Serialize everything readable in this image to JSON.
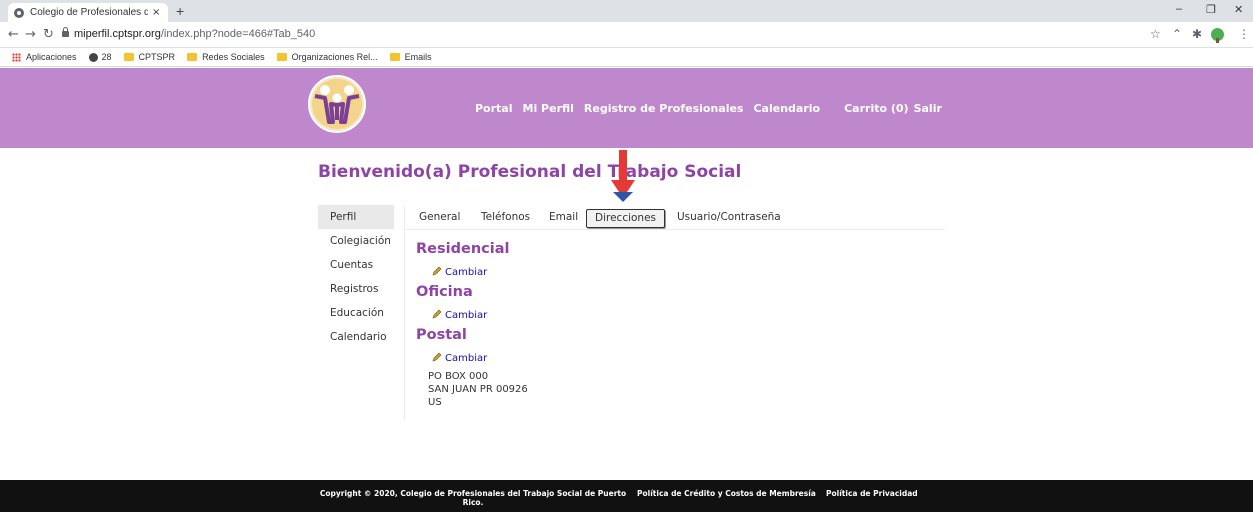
{
  "browser": {
    "tab_title": "Colegio de Profesionales del Trab",
    "tab_close": "×",
    "new_tab": "+",
    "window_controls": {
      "minimize": "–",
      "restore": "❐",
      "close": "✕"
    },
    "url_host": "miperfil.cptspr.org",
    "url_path": "/index.php?node=466#Tab_540",
    "bookmarks": [
      {
        "label": "Aplicaciones",
        "icon": "apps-grid-icon"
      },
      {
        "label": "28",
        "icon": "globe-icon"
      },
      {
        "label": "CPTSPR",
        "icon": "folder-icon"
      },
      {
        "label": "Redes Sociales",
        "icon": "folder-icon"
      },
      {
        "label": "Organizaciones Rel...",
        "icon": "folder-icon"
      },
      {
        "label": "Emails",
        "icon": "folder-icon"
      }
    ]
  },
  "header": {
    "bg_color": "#bf88cd",
    "nav": [
      "Portal",
      "Mi Perfil",
      "Registro de Profesionales",
      "Calendario",
      "Carrito (0)",
      "Salir"
    ]
  },
  "welcome": "Bienvenido(a) Profesional del Trabajo Social",
  "sidebar": {
    "items": [
      "Perfil",
      "Colegiación",
      "Cuentas",
      "Registros",
      "Educación",
      "Calendario"
    ],
    "active": "Perfil"
  },
  "tabs": {
    "items": [
      "General",
      "Teléfonos",
      "Email",
      "Direcciones",
      "Usuario/Contraseña"
    ],
    "active": "Direcciones"
  },
  "sections": {
    "residencial": {
      "title": "Residencial",
      "link": "Cambiar"
    },
    "oficina": {
      "title": "Oficina",
      "link": "Cambiar"
    },
    "postal": {
      "title": "Postal",
      "link": "Cambiar",
      "address": [
        "PO BOX 000",
        "SAN JUAN PR 00926",
        "US"
      ]
    }
  },
  "footer": {
    "copyright_line1": "Copyright © 2020, Colegio de Profesionales del Trabajo Social de Puerto",
    "copyright_line2": "Rico.",
    "links": [
      "Política de Crédito y Costos de Membresía",
      "Política de Privacidad"
    ]
  },
  "colors": {
    "accent": "#8e44a5",
    "link": "#1a0dab",
    "annotation_arrow": "#e53935"
  }
}
